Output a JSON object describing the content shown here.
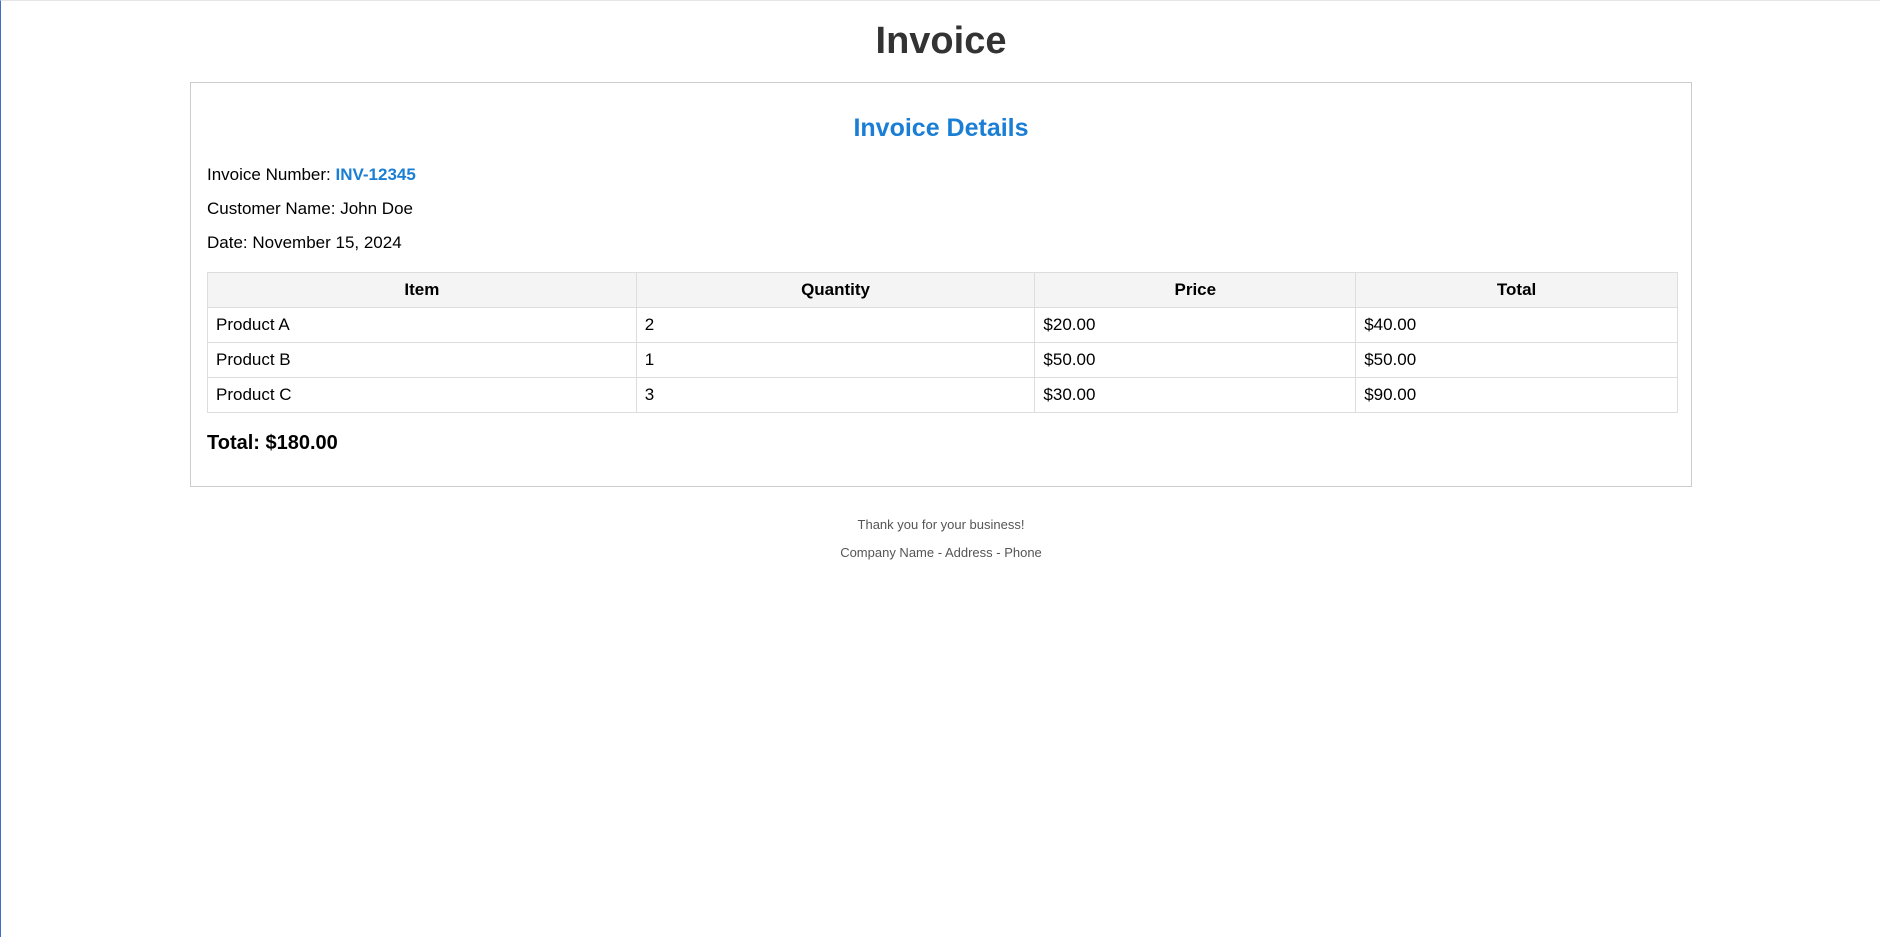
{
  "header": {
    "title": "Invoice"
  },
  "details": {
    "title": "Invoice Details",
    "invoice_number_label": "Invoice Number: ",
    "invoice_number": "INV-12345",
    "customer_label": "Customer Name: ",
    "customer_name": "John Doe",
    "date_label": "Date: ",
    "date": "November 15, 2024"
  },
  "table": {
    "headers": [
      "Item",
      "Quantity",
      "Price",
      "Total"
    ],
    "rows": [
      [
        "Product A",
        "2",
        "$20.00",
        "$40.00"
      ],
      [
        "Product B",
        "1",
        "$50.00",
        "$50.00"
      ],
      [
        "Product C",
        "3",
        "$30.00",
        "$90.00"
      ]
    ]
  },
  "summary": {
    "total": "Total: $180.00"
  },
  "footer": {
    "thanks": "Thank you for your business!",
    "company": "Company Name - Address - Phone"
  },
  "colors": {
    "accent": "#1a7fd4",
    "title": "#333333",
    "border": "#cccccc"
  }
}
